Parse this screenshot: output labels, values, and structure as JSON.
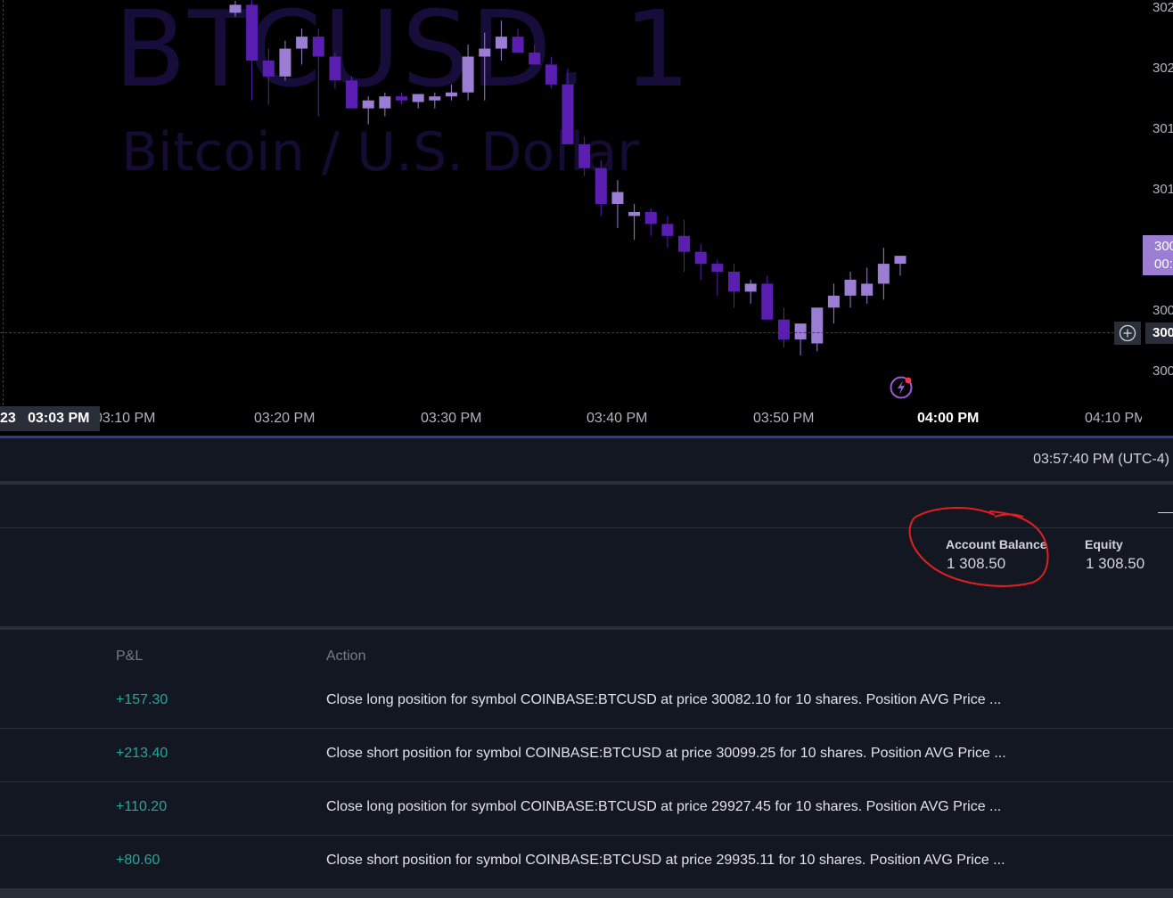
{
  "symbol_watermark": {
    "ticker": "BTCUSD, 1",
    "name": "Bitcoin / U.S. Dollar"
  },
  "chart_data": {
    "type": "candlestick",
    "interval": "1",
    "up_color": "#9b7ed3",
    "down_color": "#5a1fb0",
    "x": [
      "03:07 PM",
      "03:08 PM",
      "03:09 PM",
      "03:10 PM",
      "03:11 PM",
      "03:12 PM",
      "03:13 PM",
      "03:14 PM",
      "03:15 PM",
      "03:16 PM",
      "03:17 PM",
      "03:18 PM",
      "03:19 PM",
      "03:20 PM",
      "03:21 PM",
      "03:22 PM",
      "03:23 PM",
      "03:24 PM",
      "03:25 PM",
      "03:26 PM",
      "03:27 PM",
      "03:28 PM",
      "03:29 PM",
      "03:30 PM",
      "03:31 PM",
      "03:32 PM",
      "03:33 PM",
      "03:34 PM",
      "03:35 PM",
      "03:36 PM",
      "03:37 PM",
      "03:38 PM",
      "03:39 PM",
      "03:40 PM",
      "03:41 PM",
      "03:42 PM",
      "03:43 PM",
      "03:44 PM",
      "03:45 PM",
      "03:46 PM",
      "03:47 PM",
      "03:48 PM",
      "03:49 PM",
      "03:50 PM",
      "03:51 PM",
      "03:52 PM",
      "03:53 PM",
      "03:54 PM",
      "03:55 PM",
      "03:56 PM",
      "03:57 PM"
    ],
    "open": [
      30260,
      30270,
      30200,
      30180,
      30215,
      30230,
      30205,
      30175,
      30140,
      30140,
      30155,
      30148,
      30150,
      30155,
      30160,
      30205,
      30215,
      30230,
      30210,
      30195,
      30170,
      30095,
      30065,
      30020,
      30005,
      30010,
      29995,
      29980,
      29960,
      29945,
      29935,
      29910,
      29920,
      29875,
      29850,
      29845,
      29890,
      29905,
      29905,
      29920,
      29945
    ],
    "high": [
      30275,
      30280,
      30215,
      30225,
      30240,
      30240,
      30210,
      30180,
      30155,
      30160,
      30160,
      30158,
      30160,
      30170,
      30220,
      30235,
      30250,
      30240,
      30220,
      30205,
      30190,
      30105,
      30075,
      30050,
      30020,
      30015,
      30005,
      30000,
      29970,
      29950,
      29945,
      29925,
      29930,
      29890,
      29865,
      29870,
      29920,
      29935,
      29940,
      29965,
      29955
    ],
    "low": [
      30255,
      30150,
      30145,
      30175,
      30195,
      30130,
      30165,
      30160,
      30120,
      30130,
      30145,
      30140,
      30140,
      30150,
      30150,
      30150,
      30200,
      30210,
      30195,
      30165,
      30105,
      30055,
      30005,
      29990,
      29975,
      29980,
      29965,
      29935,
      29925,
      29905,
      29890,
      29895,
      29890,
      29840,
      29830,
      29835,
      29870,
      29890,
      29895,
      29900,
      29930
    ],
    "close": [
      30270,
      30200,
      30180,
      30215,
      30230,
      30205,
      30175,
      30140,
      30150,
      30155,
      30150,
      30158,
      30155,
      30160,
      30205,
      30215,
      30230,
      30210,
      30195,
      30170,
      30095,
      30065,
      30020,
      30035,
      30010,
      29995,
      29980,
      29960,
      29945,
      29935,
      29910,
      29920,
      29875,
      29850,
      29870,
      29890,
      29905,
      29925,
      29920,
      29945,
      29955
    ],
    "y_ticks": [
      "302",
      "302",
      "301",
      "301",
      "300",
      "300"
    ],
    "x_ticks": [
      "03:10 PM",
      "03:20 PM",
      "03:30 PM",
      "03:40 PM",
      "03:50 PM",
      "04:00 PM",
      "04:10 PM"
    ],
    "last_price_badge": [
      "300",
      "00:"
    ],
    "crosshair_price": "300",
    "crosshair_time": "23   03:03 PM"
  },
  "status": {
    "clock": "03:57:40 PM (UTC-4)"
  },
  "account": {
    "balance_label": "Account Balance",
    "balance_value": "1 308.50",
    "equity_label": "Equity",
    "equity_value": "1 308.50"
  },
  "trades": {
    "headers": {
      "pl": "P&L",
      "action": "Action"
    },
    "rows": [
      {
        "pl": "+157.30",
        "action": "Close long position for symbol COINBASE:BTCUSD at price 30082.10 for 10 shares. Position AVG Price ..."
      },
      {
        "pl": "+213.40",
        "action": "Close short position for symbol COINBASE:BTCUSD at price 30099.25 for 10 shares. Position AVG Price ..."
      },
      {
        "pl": "+110.20",
        "action": "Close long position for symbol COINBASE:BTCUSD at price 29927.45 for 10 shares. Position AVG Price ..."
      },
      {
        "pl": "+80.60",
        "action": "Close short position for symbol COINBASE:BTCUSD at price 29935.11 for 10 shares. Position AVG Price ..."
      }
    ]
  },
  "icons": {
    "plus": "add-alert-icon",
    "replay": "lightning-icon",
    "minimize": "minimize-icon"
  }
}
